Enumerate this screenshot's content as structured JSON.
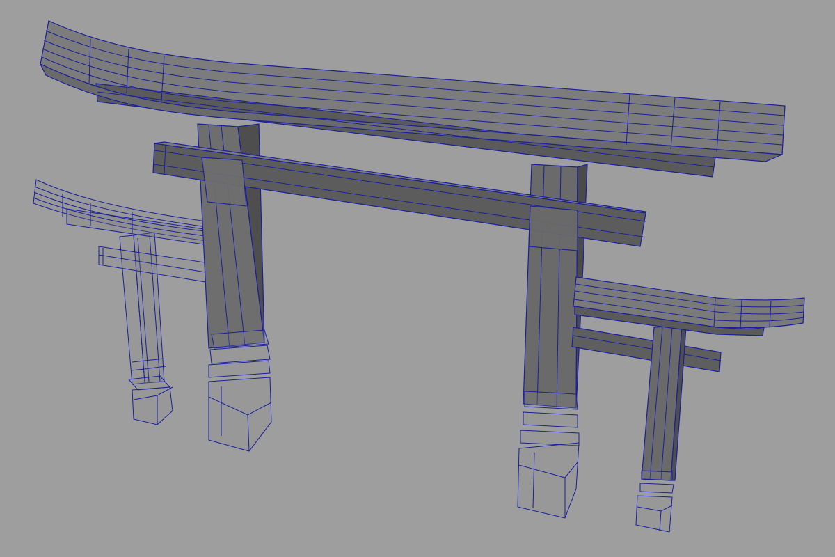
{
  "viewport": {
    "background": "#9e9e9e",
    "wireframe_color": "#1a1f9c",
    "surface_color": "#6b6b6b",
    "surface_dark": "#4c4c4c",
    "surface_light": "#8a8a8a"
  },
  "scene": {
    "objects": [
      "large-torii-gate",
      "small-torii-gate-left",
      "small-torii-gate-right"
    ]
  }
}
